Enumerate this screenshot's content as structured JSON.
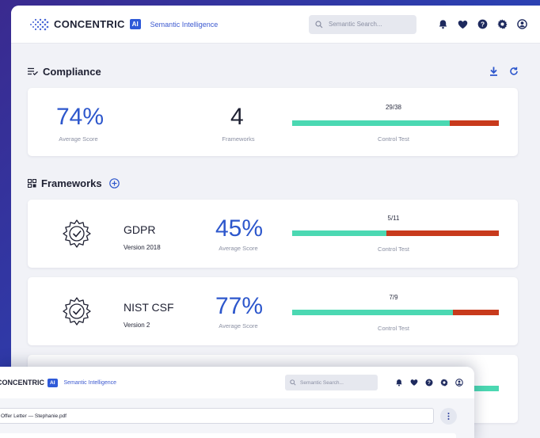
{
  "brand": {
    "name": "CONCENTRIC",
    "badge": "AI",
    "tagline": "Semantic Intelligence"
  },
  "search": {
    "placeholder": "Semantic Search..."
  },
  "top_icons": [
    "bell-icon",
    "heart-icon",
    "help-icon",
    "gear-icon",
    "user-icon"
  ],
  "compliance": {
    "title": "Compliance",
    "average_score": "74%",
    "average_score_label": "Average Score",
    "frameworks_count": "4",
    "frameworks_label": "Frameworks",
    "control_ratio": "29/38",
    "control_fraction": 0.763,
    "control_label": "Control Test"
  },
  "frameworks_section": {
    "title": "Frameworks"
  },
  "frameworks": [
    {
      "name": "GDPR",
      "version": "Version 2018",
      "score": "45%",
      "score_label": "Average Score",
      "ratio": "5/11",
      "fraction": 0.455,
      "control_label": "Control Test"
    },
    {
      "name": "NIST CSF",
      "version": "Version 2",
      "score": "77%",
      "score_label": "Average Score",
      "ratio": "7/9",
      "fraction": 0.778,
      "control_label": "Control Test"
    }
  ],
  "overlay": {
    "brand": "CONCENTRIC",
    "badge": "AI",
    "tagline": "Semantic Intelligence",
    "search_placeholder": "Semantic Search...",
    "document": "Offer Letter — Stephanie.pdf"
  },
  "colors": {
    "accent": "#2d57cc",
    "pass": "#4bd8b2",
    "fail": "#c83a1c"
  }
}
